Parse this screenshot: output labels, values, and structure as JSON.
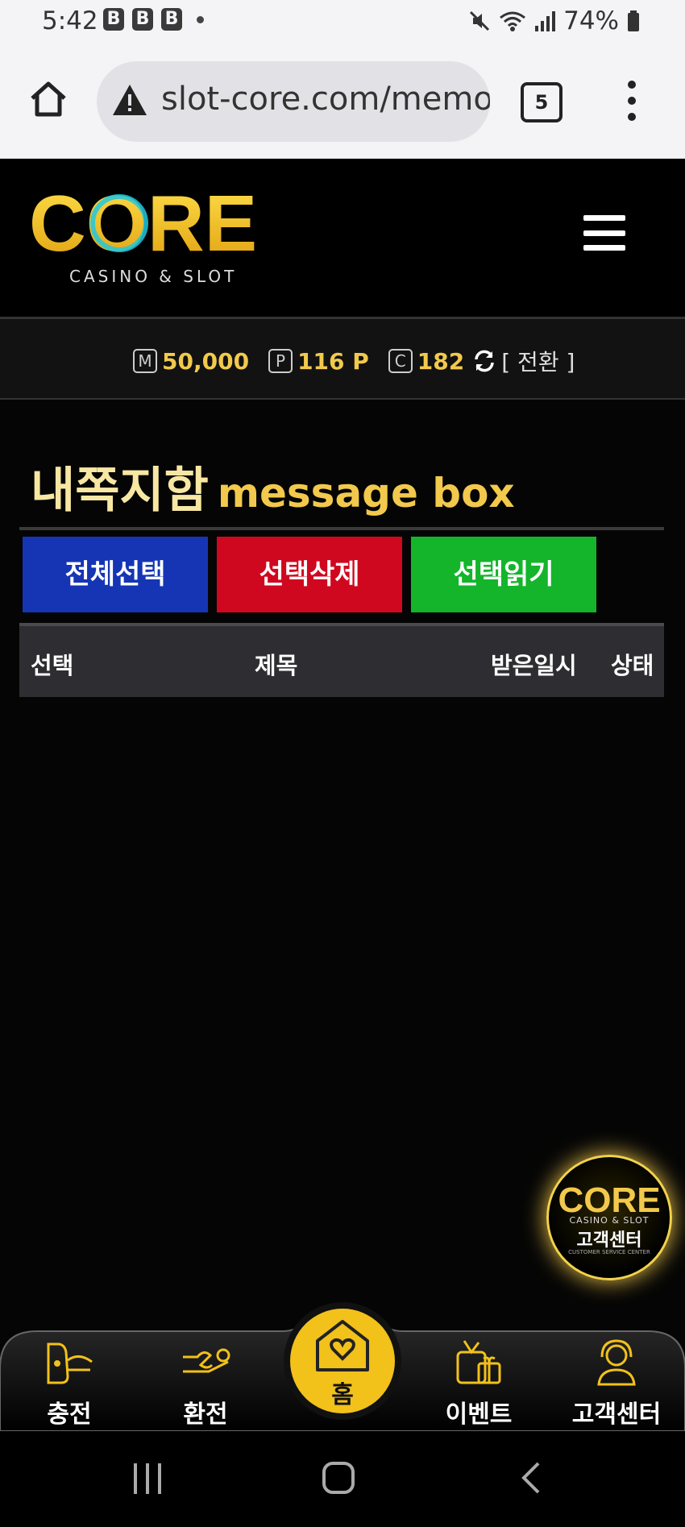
{
  "status_bar": {
    "time": "5:42",
    "battery": "74%",
    "notif_badges": [
      "B",
      "B",
      "B"
    ]
  },
  "browser": {
    "url": "slot-core.com/memo",
    "tab_count": "5"
  },
  "logo": {
    "text": "CORE",
    "subtitle": "CASINO & SLOT"
  },
  "balance": {
    "money_icon": "M",
    "money": "50,000",
    "point_icon": "P",
    "point": "116 P",
    "coin_icon": "C",
    "coin": "182",
    "switch_label": "[ 전환 ]"
  },
  "page_title": {
    "korean": "내쪽지함",
    "english": "message box"
  },
  "actions": {
    "select_all": "전체선택",
    "delete_selected": "선택삭제",
    "read_selected": "선택읽기"
  },
  "table": {
    "headers": {
      "select": "선택",
      "title": "제목",
      "received": "받은일시",
      "status": "상태"
    }
  },
  "customer_badge": {
    "logo": "CORE",
    "subtitle": "CASINO & SLOT",
    "label": "고객센터",
    "caption": "CUSTOMER SERVICE CENTER"
  },
  "bottom_nav": {
    "charge": "충전",
    "exchange": "환전",
    "home": "홈",
    "event": "이벤트",
    "support": "고객센터"
  },
  "colors": {
    "accent_gold": "#f2c94c",
    "select_all_bg": "#1535b5",
    "delete_bg": "#d0081f",
    "read_bg": "#14b52a"
  }
}
